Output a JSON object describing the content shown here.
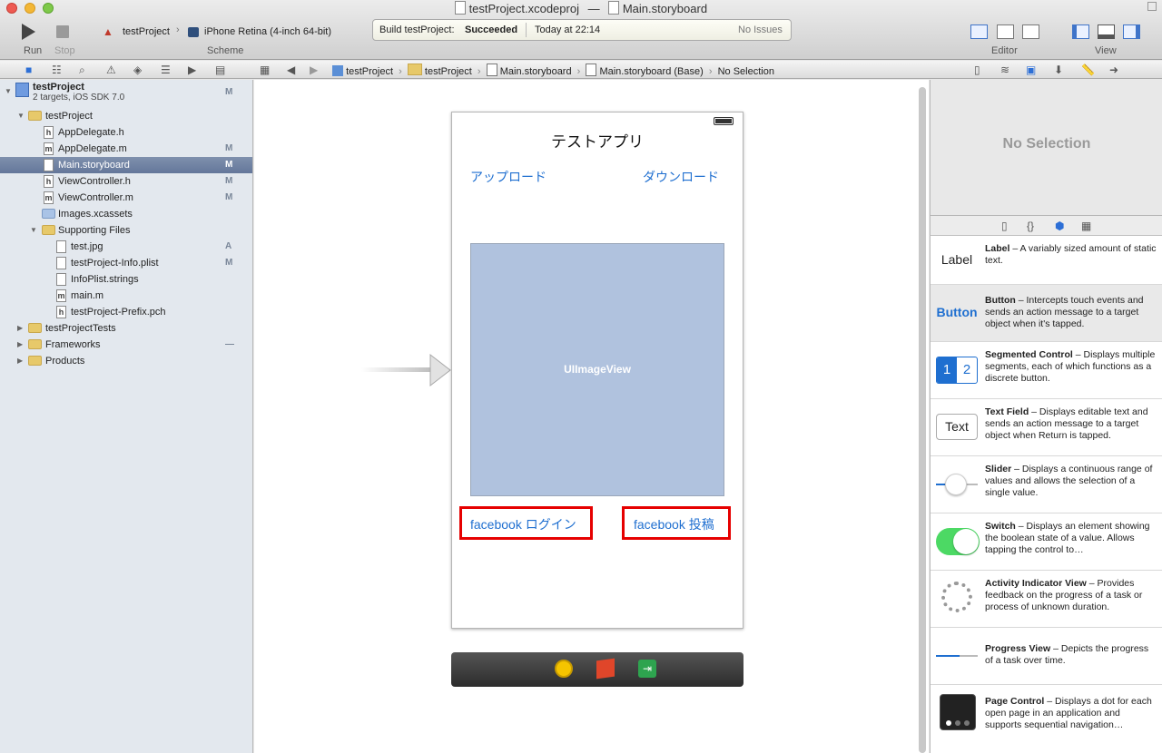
{
  "window": {
    "title_project": "testProject.xcodeproj",
    "title_sep": "—",
    "title_file": "Main.storyboard"
  },
  "toolbar": {
    "run_label": "Run",
    "stop_label": "Stop",
    "scheme_project": "testProject",
    "scheme_device": "iPhone Retina (4-inch 64-bit)",
    "scheme_label": "Scheme",
    "editor_label": "Editor",
    "view_label": "View"
  },
  "status": {
    "build_prefix": "Build testProject:",
    "build_result": "Succeeded",
    "time": "Today at 22:14",
    "issues": "No Issues"
  },
  "jumpbar": [
    "testProject",
    "testProject",
    "Main.storyboard",
    "Main.storyboard (Base)",
    "No Selection"
  ],
  "navigator": {
    "project_name": "testProject",
    "project_sub": "2 targets, iOS SDK 7.0",
    "project_badge": "M",
    "items": [
      {
        "label": "testProject",
        "badge": ""
      },
      {
        "label": "AppDelegate.h",
        "badge": ""
      },
      {
        "label": "AppDelegate.m",
        "badge": "M"
      },
      {
        "label": "Main.storyboard",
        "badge": "M"
      },
      {
        "label": "ViewController.h",
        "badge": "M"
      },
      {
        "label": "ViewController.m",
        "badge": "M"
      },
      {
        "label": "Images.xcassets",
        "badge": ""
      },
      {
        "label": "Supporting Files",
        "badge": ""
      },
      {
        "label": "test.jpg",
        "badge": "A"
      },
      {
        "label": "testProject-Info.plist",
        "badge": "M"
      },
      {
        "label": "InfoPlist.strings",
        "badge": ""
      },
      {
        "label": "main.m",
        "badge": ""
      },
      {
        "label": "testProject-Prefix.pch",
        "badge": ""
      },
      {
        "label": "testProjectTests",
        "badge": ""
      },
      {
        "label": "Frameworks",
        "badge": "—"
      },
      {
        "label": "Products",
        "badge": ""
      }
    ]
  },
  "storyboard": {
    "app_title": "テストアプリ",
    "upload_label": "アップロード",
    "download_label": "ダウンロード",
    "imageview_label": "UIImageView",
    "fb_login_label": "facebook ログイン",
    "fb_post_label": "facebook 投稿"
  },
  "inspector": {
    "no_selection": "No Selection"
  },
  "library": [
    {
      "name": "Label",
      "desc": " – A variably sized amount of static text.",
      "icon_text": "Label"
    },
    {
      "name": "Button",
      "desc": " – Intercepts touch events and sends an action message to a target object when it's tapped.",
      "icon_text": "Button"
    },
    {
      "name": "Segmented Control",
      "desc": " – Displays multiple segments, each of which functions as a discrete button.",
      "icon_text_1": "1",
      "icon_text_2": "2"
    },
    {
      "name": "Text Field",
      "desc": " – Displays editable text and sends an action message to a target object when Return is tapped.",
      "icon_text": "Text"
    },
    {
      "name": "Slider",
      "desc": " – Displays a continuous range of values and allows the selection of a single value."
    },
    {
      "name": "Switch",
      "desc": " – Displays an element showing the boolean state of a value. Allows tapping the control to…"
    },
    {
      "name": "Activity Indicator View",
      "desc": " – Provides feedback on the progress of a task or process of unknown duration."
    },
    {
      "name": "Progress View",
      "desc": " – Depicts the progress of a task over time."
    },
    {
      "name": "Page Control",
      "desc": " – Displays a dot for each open page in an application and supports sequential navigation…"
    }
  ],
  "colors": {
    "accent": "#1f6fd0",
    "highlight_red": "#e60000",
    "selection": "#6f81a3",
    "imageview_fill": "#b0c2de"
  }
}
